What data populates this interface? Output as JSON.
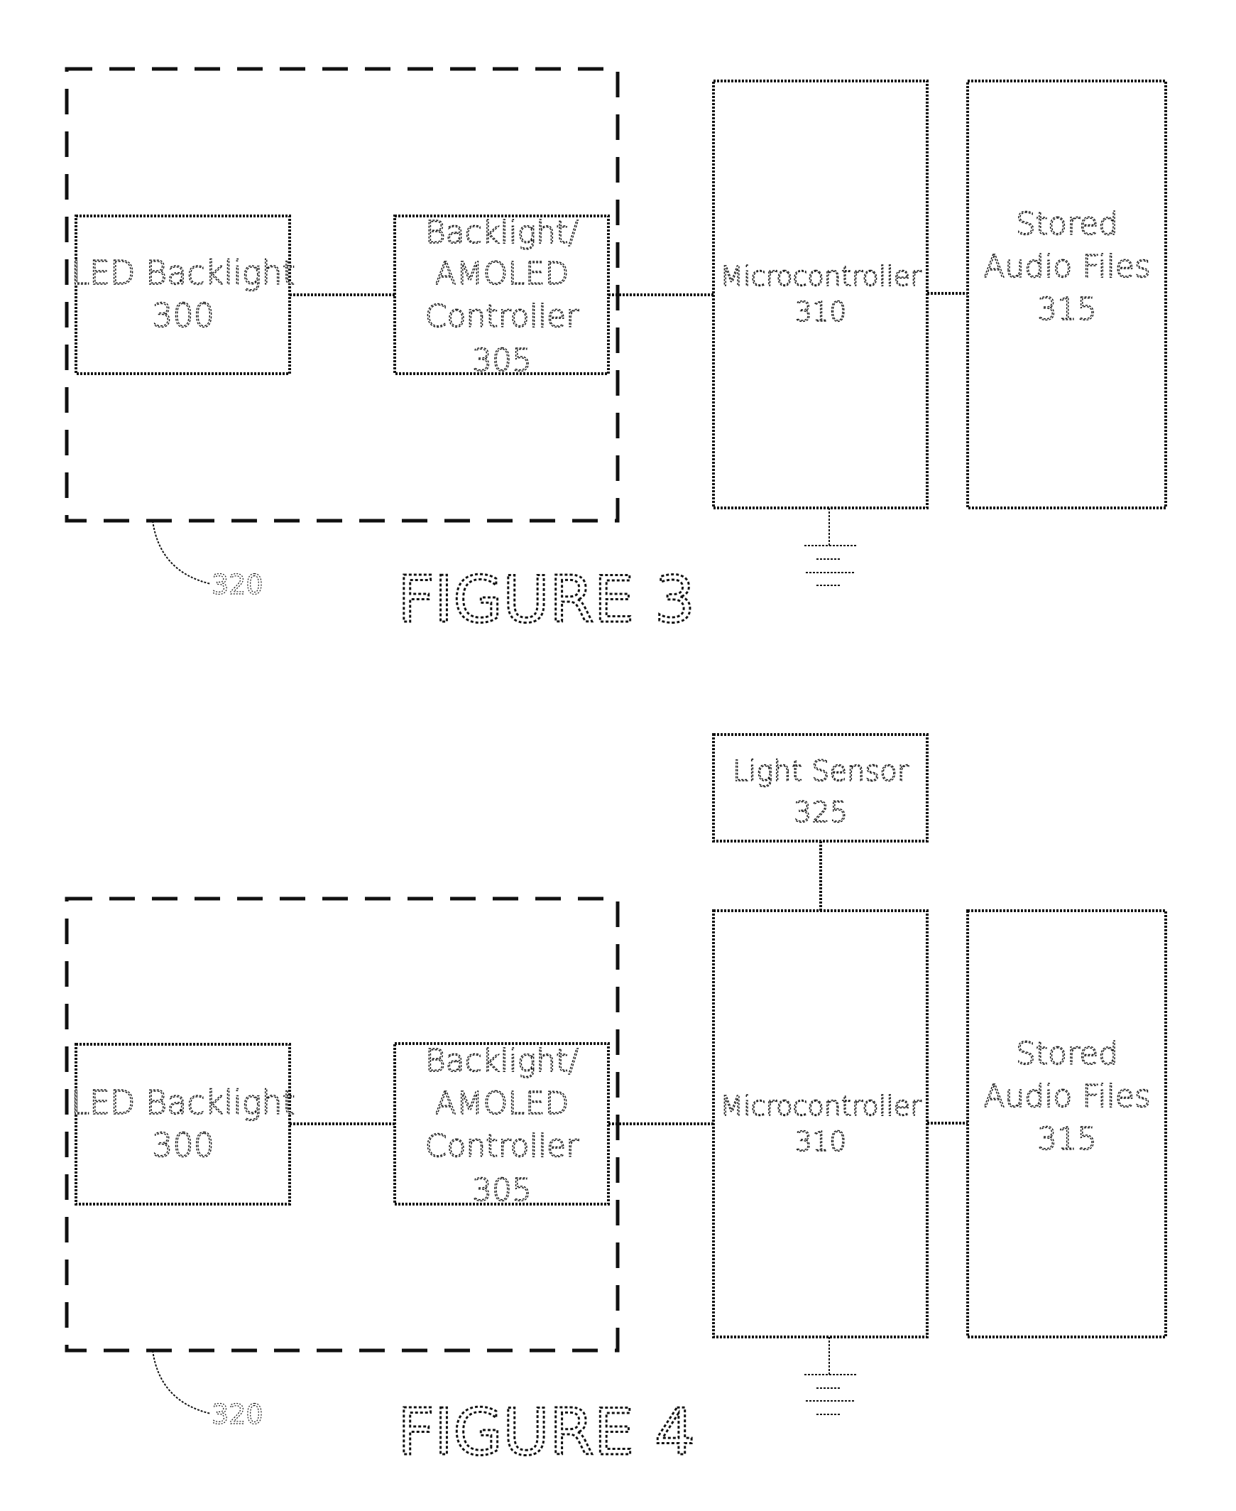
{
  "figures": [
    {
      "id": "figure-3",
      "caption": "FIGURE 3",
      "group_ref": "320",
      "blocks": {
        "led": [
          "LED Backlight",
          "300"
        ],
        "controller": [
          "Backlight/",
          "AMOLED",
          "Controller",
          "305"
        ],
        "micro": [
          "Microcontroller",
          "310"
        ],
        "stored": [
          "Stored",
          "Audio Files",
          "315"
        ]
      },
      "has_light_sensor": false,
      "has_ground": true
    },
    {
      "id": "figure-4",
      "caption": "FIGURE 4",
      "group_ref": "320",
      "blocks": {
        "led": [
          "LED Backlight",
          "300"
        ],
        "controller": [
          "Backlight/",
          "AMOLED",
          "Controller",
          "305"
        ],
        "micro": [
          "Microcontroller",
          "310"
        ],
        "stored": [
          "Stored",
          "Audio Files",
          "315"
        ],
        "sensor": [
          "Light Sensor",
          "325"
        ]
      },
      "has_light_sensor": true,
      "has_ground": true
    }
  ]
}
